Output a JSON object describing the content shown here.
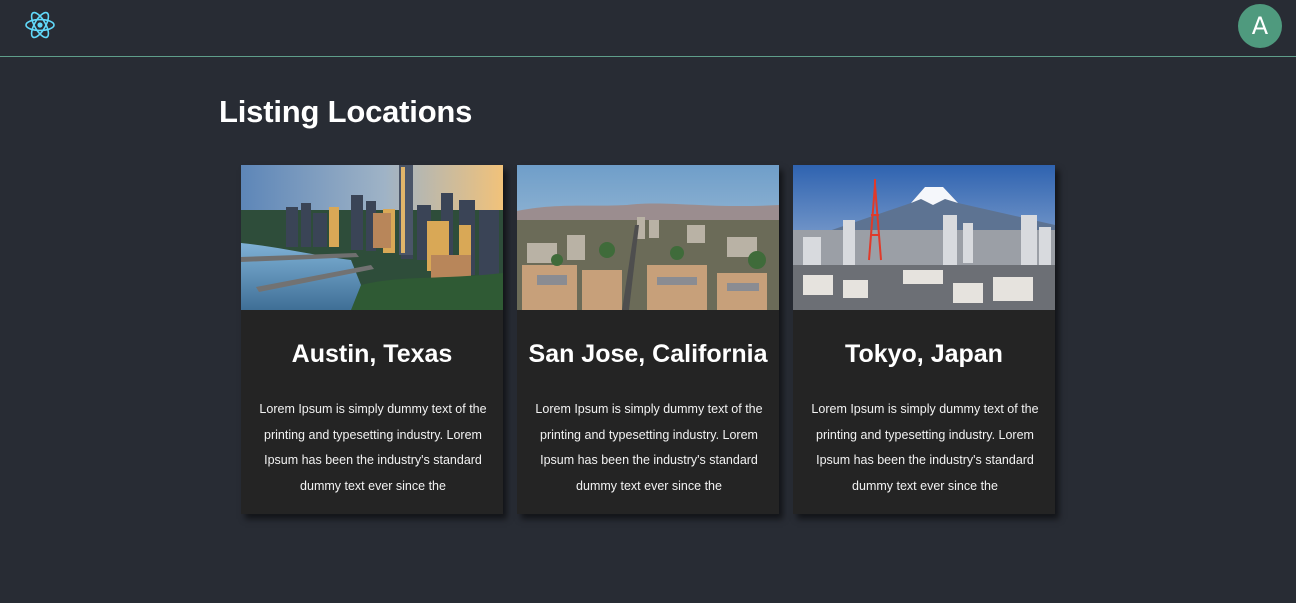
{
  "header": {
    "logo_icon": "react-atom-icon",
    "avatar_letter": "A",
    "avatar_color": "#4f9a7e",
    "divider_color": "#5f9e8a"
  },
  "main": {
    "title": "Listing Locations",
    "cards": [
      {
        "title": "Austin, Texas",
        "image": "austin-skyline-photo",
        "text": "Lorem Ipsum is simply dummy text of the printing and typesetting industry. Lorem Ipsum has been the industry's standard dummy text ever since the"
      },
      {
        "title": "San Jose, California",
        "image": "san-jose-cityscape-photo",
        "text": "Lorem Ipsum is simply dummy text of the printing and typesetting industry. Lorem Ipsum has been the industry's standard dummy text ever since the"
      },
      {
        "title": "Tokyo, Japan",
        "image": "tokyo-mount-fuji-photo",
        "text": "Lorem Ipsum is simply dummy text of the printing and typesetting industry. Lorem Ipsum has been the industry's standard dummy text ever since the"
      }
    ]
  },
  "colors": {
    "background": "#282c34",
    "card_background": "#242424",
    "react_blue": "#61dafb"
  }
}
